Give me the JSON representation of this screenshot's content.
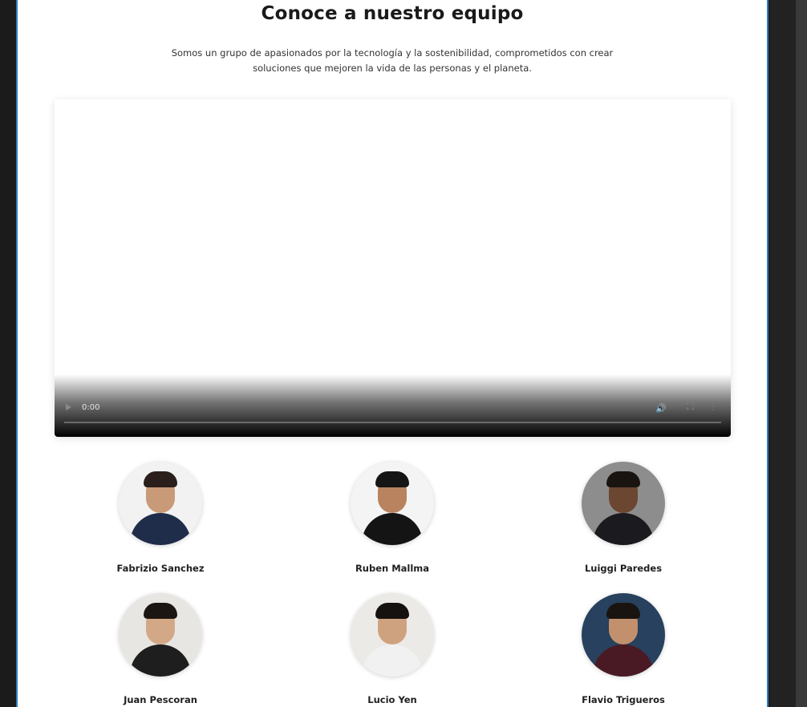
{
  "page": {
    "title": "Conoce a nuestro equipo",
    "subtitle": "Somos un grupo de apasionados por la tecnología y la sostenibilidad, comprometidos con crear soluciones que mejoren la vida de las personas y el planeta."
  },
  "video": {
    "time": "0:00",
    "progress": 0,
    "icons": [
      "play-icon",
      "volume-icon",
      "fullscreen-icon",
      "more-options-icon"
    ]
  },
  "team": [
    {
      "name": "Fabrizio Sanchez",
      "bg": "#f2f2f2",
      "skin": "#c99a78",
      "hair": "#2a1f1a",
      "suit": "#1f2d4a"
    },
    {
      "name": "Ruben Mallma",
      "bg": "#f4f4f4",
      "skin": "#b8835e",
      "hair": "#151515",
      "suit": "#141414"
    },
    {
      "name": "Luiggi Paredes",
      "bg": "#8d8d8d",
      "skin": "#6b4630",
      "hair": "#1a1410",
      "suit": "#1b1b1f"
    },
    {
      "name": "Juan Pescoran",
      "bg": "#e8e6e2",
      "skin": "#d2a886",
      "hair": "#1c1612",
      "suit": "#1e1e1e"
    },
    {
      "name": "Lucio Yen",
      "bg": "#eceae6",
      "skin": "#cfa27f",
      "hair": "#161210",
      "suit": "#f1f1f1"
    },
    {
      "name": "Flavio Trigueros",
      "bg": "#27415e",
      "skin": "#c2906c",
      "hair": "#1a1410",
      "suit": "#4a1a24"
    }
  ]
}
